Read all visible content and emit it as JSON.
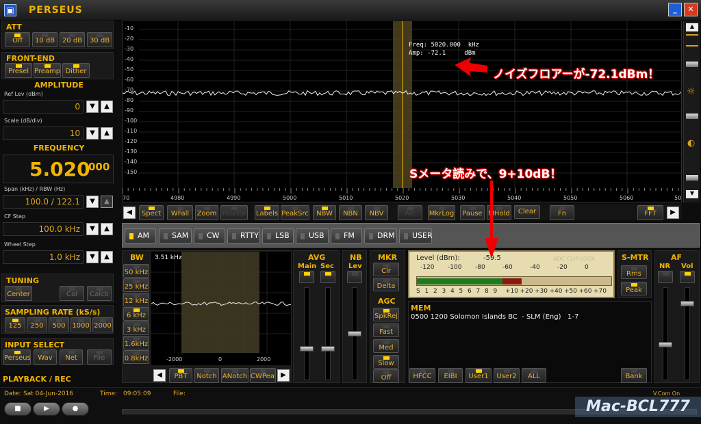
{
  "app": {
    "title": "PERSEUS"
  },
  "att": {
    "title": "ATT",
    "buttons": [
      "Off",
      "10 dB",
      "20 dB",
      "30 dB"
    ]
  },
  "frontend": {
    "title": "FRONT-END",
    "buttons": [
      "Presel",
      "Preamp",
      "Dither"
    ]
  },
  "amplitude": {
    "title": "AMPLITUDE",
    "ref_label": "Ref Lev (dBm)",
    "ref_value": "0",
    "scale_label": "Scale (dB/div)",
    "scale_value": "10"
  },
  "frequency": {
    "title": "FREQUENCY",
    "main": "5.020",
    "fine": "000",
    "span_label": "Span (kHz) / RBW (Hz)",
    "span_value": "100.0 / 122.1",
    "cf_label": "CF Step",
    "cf_value": "100.0 kHz",
    "wheel_label": "Wheel Step",
    "wheel_value": "1.0 kHz"
  },
  "tuning": {
    "title": "TUNING",
    "buttons": [
      "Center",
      "Cal",
      "Calcb"
    ]
  },
  "sampling": {
    "title": "SAMPLING RATE (kS/s)",
    "buttons": [
      "125",
      "250",
      "500",
      "1000",
      "2000"
    ]
  },
  "input": {
    "title": "INPUT SELECT",
    "buttons": [
      "Perseus",
      "Wav",
      "Net",
      "File"
    ]
  },
  "playback": {
    "title": "PLAYBACK / REC"
  },
  "status": {
    "date_label": "Date:",
    "date_value": "Sat 04-Jun-2016",
    "time_label": "Time:",
    "time_value": "09:05:09",
    "file_label": "File:",
    "vcom": "V.Com On"
  },
  "spectrum": {
    "y_labels": [
      "-10",
      "-20",
      "-30",
      "-40",
      "-50",
      "-60",
      "-70",
      "-80",
      "-90",
      "-100",
      "-110",
      "-120",
      "-130",
      "-140",
      "-150"
    ],
    "x_labels": [
      "70",
      "4980",
      "4990",
      "5000",
      "5010",
      "5020",
      "5030",
      "5040",
      "5050",
      "5060",
      "50"
    ],
    "freq_readout": "Freq: 5020.000  kHz",
    "amp_readout": "Amp: -72.1     dBm",
    "noise_floor_dbm": -72.1
  },
  "spectrum_toolbar": [
    "Spect",
    "WFall",
    "Zoom",
    "Palette",
    "Labels",
    "PeakSrc",
    "NBW",
    "NBN",
    "NBV",
    "Afc",
    "MkrLog",
    "Pause",
    "MHold",
    "Clear",
    "Fn",
    "FFT"
  ],
  "modes": [
    "AM",
    "SAM",
    "CW",
    "RTTY",
    "LSB",
    "USB",
    "FM",
    "DRM",
    "USER"
  ],
  "bw": {
    "title": "BW",
    "buttons": [
      "50 kHz",
      "25 kHz",
      "12 kHz",
      "6 kHz",
      "3 kHz",
      "1.6kHz",
      "0.8kHz"
    ],
    "readout": "3.51 kHz",
    "x_labels": [
      "-2000",
      "0",
      "2000"
    ]
  },
  "bw_toolbar": [
    "PBT",
    "Notch",
    "ANotch",
    "CWPeak"
  ],
  "avg": {
    "title": "AVG",
    "main": "Main",
    "sec": "Sec"
  },
  "nb": {
    "title": "NB",
    "lev": "Lev"
  },
  "mkr": {
    "title": "MKR",
    "buttons": [
      "Clr",
      "Delta"
    ]
  },
  "agc": {
    "title": "AGC",
    "buttons": [
      "SpkRej",
      "Fast",
      "Med",
      "Slow",
      "Off"
    ]
  },
  "smeter": {
    "level_label": "Level (dBm):",
    "level_value": "-59.5",
    "flags": "ADC CLIP LOCK",
    "top_scale": [
      "-120",
      "-100",
      "-80",
      "-60",
      "-40",
      "-20",
      "0"
    ],
    "bottom_scale": [
      "S",
      "1",
      "2",
      "3",
      "4",
      "5",
      "6",
      "7",
      "8",
      "9",
      "+10",
      "+20",
      "+30",
      "+40",
      "+50",
      "+60",
      "+70"
    ],
    "green_fraction": 0.44,
    "red_fraction": 0.1,
    "title": "S-MTR",
    "buttons": [
      "Rms",
      "Peak"
    ]
  },
  "mem": {
    "title": "MEM",
    "entry": "0500 1200 Solomon Islands BC  - SLM (Eng)   1-7",
    "buttons": [
      "HFCC",
      "EIBI",
      "User1",
      "User2",
      "ALL",
      "Bank"
    ]
  },
  "af": {
    "title": "AF",
    "nr": "NR",
    "vol": "Vol"
  },
  "annotations": {
    "noise": "ノイズフロアーが-72.1dBm！",
    "smeter": "Sメータ読みで、9+10dB！"
  },
  "watermark": "Mac-BCL777",
  "colors": {
    "accent": "#f0b400",
    "led_on": "#ffd400",
    "annotation": "#e00000"
  }
}
